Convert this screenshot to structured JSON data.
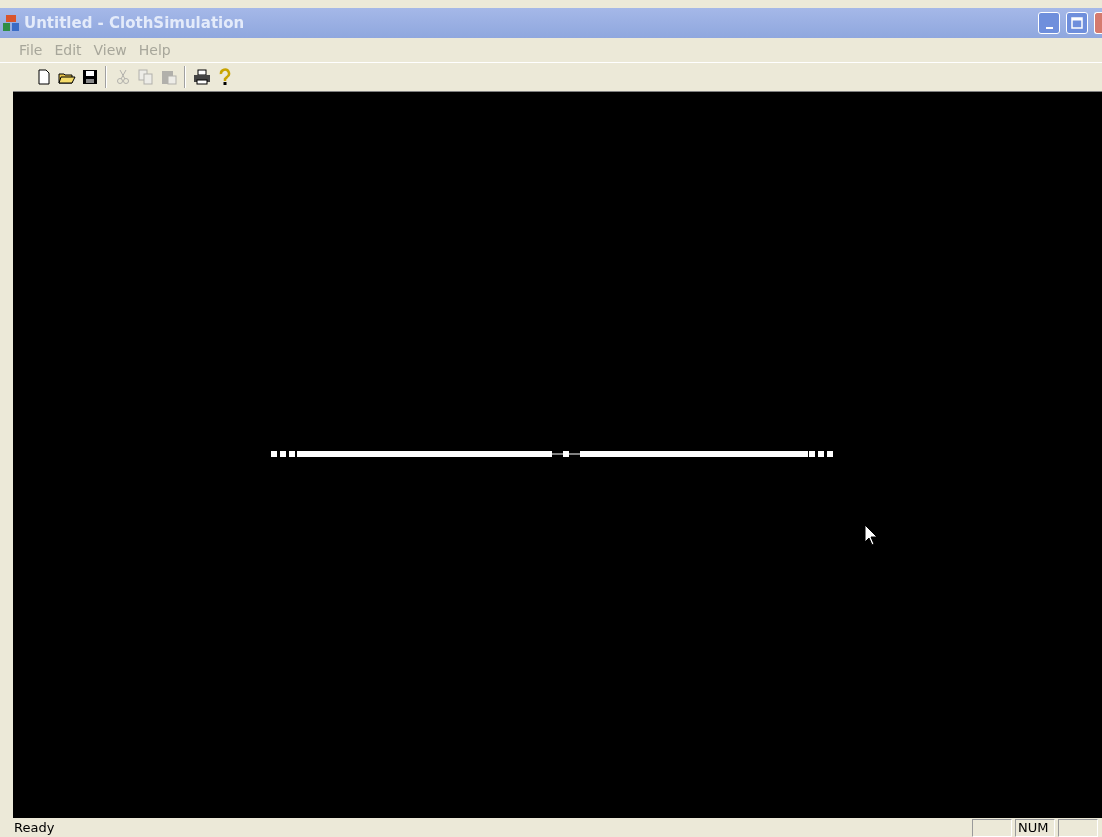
{
  "window": {
    "title": "Untitled - ClothSimulation",
    "active": false
  },
  "menu": [
    {
      "label": "File"
    },
    {
      "label": "Edit"
    },
    {
      "label": "View"
    },
    {
      "label": "Help"
    }
  ],
  "toolbar": [
    {
      "kind": "new",
      "disabled": false
    },
    {
      "kind": "open",
      "disabled": false
    },
    {
      "kind": "save",
      "disabled": false
    },
    {
      "kind": "separator"
    },
    {
      "kind": "cut",
      "disabled": true
    },
    {
      "kind": "copy",
      "disabled": true
    },
    {
      "kind": "paste",
      "disabled": true
    },
    {
      "kind": "separator"
    },
    {
      "kind": "print",
      "disabled": false
    },
    {
      "kind": "help",
      "disabled": false
    }
  ],
  "status_bar": {
    "text": "Ready",
    "indicator": "NUM"
  }
}
